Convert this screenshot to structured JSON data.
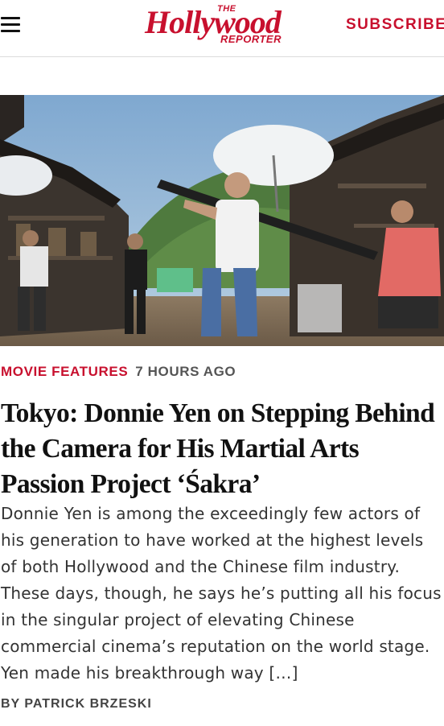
{
  "header": {
    "logo_the": "THE",
    "logo_main": "Hollywood",
    "logo_reporter": "REPORTER",
    "subscribe_label": "SUBSCRIBE",
    "menu_icon": "hamburger-menu-icon",
    "brand_color": "#c8102e"
  },
  "article": {
    "category": "MOVIE FEATURES",
    "time": "7 HOURS AGO",
    "headline": "Tokyo: Donnie Yen on Stepping Behind the Camera for His Martial Arts Passion Project ‘Śakra’",
    "excerpt": "Donnie Yen is among the exceedingly few actors of his generation to have worked at the highest levels of both Hollywood and the Chinese film industry. These days, though, he says he’s putting all his focus in the singular project of elevating Chinese commercial cinema’s reputation on the world stage.  Yen made his breakthrough way […]",
    "byline_prefix": "BY",
    "author": "PATRICK BRZESKI"
  }
}
